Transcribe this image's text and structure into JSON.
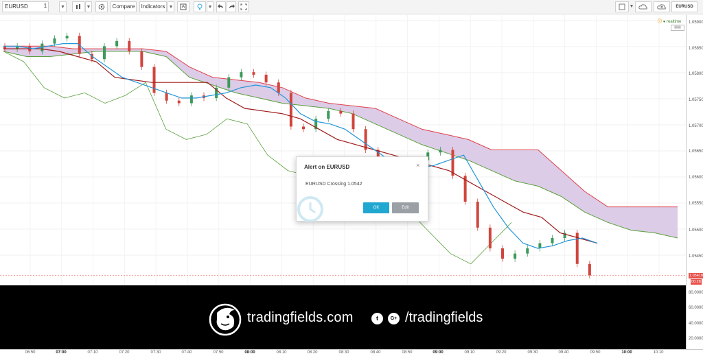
{
  "toolbar": {
    "symbol": "EURUSD",
    "interval": "1",
    "compare_label": "Compare",
    "indicators_label": "Indicators",
    "right_symbol": "EURUSD"
  },
  "chart": {
    "status_label": "realtime",
    "price_tag_current": "1.05418",
    "price_tag_countdown": "00:28"
  },
  "y_axis_labels": [
    "1.05900",
    "1.05850",
    "1.05800",
    "1.05750",
    "1.05700",
    "1.05650",
    "1.05600",
    "1.05550",
    "1.05500",
    "1.05450"
  ],
  "indicator_axis_labels": [
    "80.0000",
    "60.0000",
    "40.0000",
    "20.0000"
  ],
  "x_axis_labels": [
    {
      "text": "06:50",
      "bold": false
    },
    {
      "text": "07:00",
      "bold": true
    },
    {
      "text": "07:10",
      "bold": false
    },
    {
      "text": "07:20",
      "bold": false
    },
    {
      "text": "07:30",
      "bold": false
    },
    {
      "text": "07:40",
      "bold": false
    },
    {
      "text": "07:50",
      "bold": false
    },
    {
      "text": "08:00",
      "bold": true
    },
    {
      "text": "08:10",
      "bold": false
    },
    {
      "text": "08:20",
      "bold": false
    },
    {
      "text": "08:30",
      "bold": false
    },
    {
      "text": "08:40",
      "bold": false
    },
    {
      "text": "08:50",
      "bold": false
    },
    {
      "text": "09:00",
      "bold": true
    },
    {
      "text": "09:10",
      "bold": false
    },
    {
      "text": "09:20",
      "bold": false
    },
    {
      "text": "09:30",
      "bold": false
    },
    {
      "text": "09:40",
      "bold": false
    },
    {
      "text": "09:50",
      "bold": false
    },
    {
      "text": "10:00",
      "bold": true
    },
    {
      "text": "10:10",
      "bold": false
    }
  ],
  "dialog": {
    "title": "Alert on EURUSD",
    "close_symbol": "×",
    "message": "EURUSD Crossing 1.0542",
    "ok_label": "OK",
    "edit_label": "Edit"
  },
  "banner": {
    "brand": "tradingfields.com",
    "twitter_glyph": "t",
    "gplus_glyph": "G+",
    "handle": "/tradingfields"
  },
  "colors": {
    "cloud_fill": "#d8c6e4",
    "cloud_upper": "#e0404a",
    "cloud_lower": "#5aa03c",
    "tenkan": "#2196d8",
    "kijun": "#a01c1c",
    "candle_up": "#3c9a5a",
    "candle_down": "#d0453c",
    "ok_button": "#20a8d0",
    "edit_button": "#9aa0a6",
    "banner_bg": "#000000"
  },
  "chart_data": {
    "type": "candlestick",
    "symbol": "EURUSD",
    "ylim": [
      1.054,
      1.0592
    ],
    "candles_close": [
      1.05855,
      1.0586,
      1.0585,
      1.05865,
      1.05875,
      1.0588,
      1.05845,
      1.05835,
      1.0586,
      1.0587,
      1.0585,
      1.0582,
      1.0577,
      1.05755,
      1.0575,
      1.05765,
      1.0576,
      1.0578,
      1.058,
      1.0581,
      1.05805,
      1.0579,
      1.0577,
      1.05705,
      1.057,
      1.0572,
      1.05735,
      1.0573,
      1.057,
      1.0566,
      1.0564,
      1.05625,
      1.0562,
      1.0564,
      1.05655,
      1.0566,
      1.0561,
      1.0556,
      1.0551,
      1.0547,
      1.0545,
      1.0546,
      1.0547,
      1.0548,
      1.0549,
      1.055,
      1.0544,
      1.05418
    ],
    "tenkan": [
      1.0586,
      1.0586,
      1.05855,
      1.0586,
      1.05865,
      1.05865,
      1.0584,
      1.0582,
      1.058,
      1.0579,
      1.0578,
      1.0577,
      1.0576,
      1.0576,
      1.05765,
      1.0577,
      1.0578,
      1.05785,
      1.0578,
      1.0576,
      1.0573,
      1.05715,
      1.0571,
      1.057,
      1.0568,
      1.0566,
      1.0564,
      1.0563,
      1.05625,
      1.0563,
      1.0564,
      1.0565,
      1.056,
      1.0555,
      1.0551,
      1.0548,
      1.0547,
      1.05475,
      1.05485,
      1.0549,
      1.0548
    ],
    "kijun": [
      1.05855,
      1.05855,
      1.05855,
      1.0585,
      1.0584,
      1.0583,
      1.058,
      1.05795,
      1.0579,
      1.0579,
      1.0579,
      1.0579,
      1.0576,
      1.0574,
      1.05735,
      1.0573,
      1.0572,
      1.057,
      1.0568,
      1.0567,
      1.0566,
      1.0565,
      1.0564,
      1.0563,
      1.0562,
      1.056,
      1.0558,
      1.0556,
      1.0554,
      1.0553,
      1.055,
      1.0549,
      1.0548
    ]
  }
}
